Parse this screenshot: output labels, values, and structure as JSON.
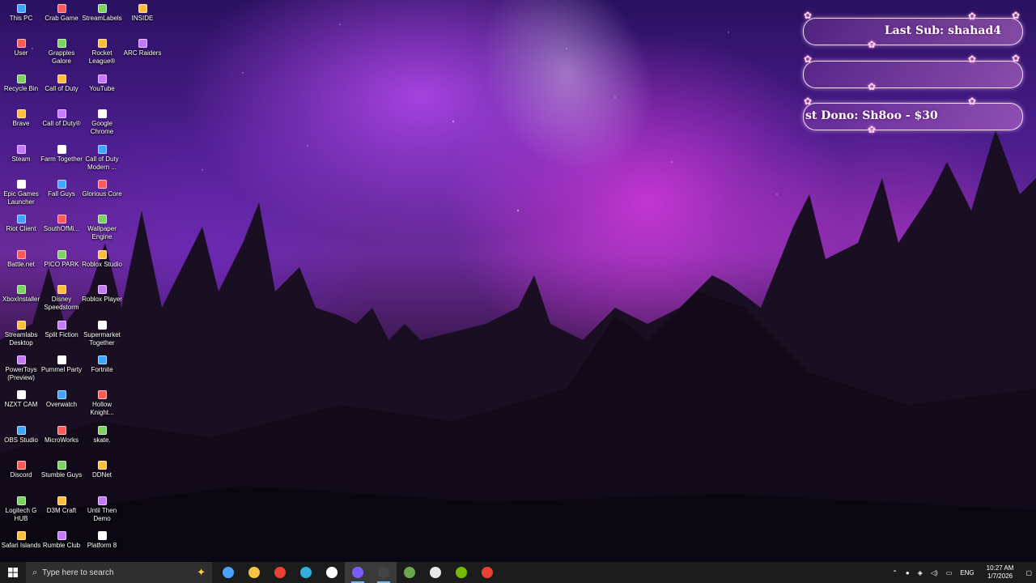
{
  "overlay": {
    "last_sub": "Last Sub: shahad4",
    "middle": "",
    "last_dono": "st Dono: Sh8oo - $30"
  },
  "desktop_icons": {
    "col1": [
      "This PC",
      "User",
      "Recycle Bin",
      "Brave",
      "Steam",
      "Epic Games Launcher",
      "Riot Client",
      "Battle.net",
      "XboxInstaller",
      "Streamlabs Desktop",
      "PowerToys (Preview)",
      "NZXT CAM",
      "OBS Studio",
      "Discord",
      "Logitech G HUB",
      "Safari Islands"
    ],
    "col2": [
      "Crab Game",
      "Grapples Galore",
      "Call of Duty",
      "Call of Duty®",
      "Farm Together",
      "Fall Guys",
      "SouthOfMi...",
      "PICO PARK",
      "Disney Speedstorm",
      "Split Fiction",
      "Pummel Party",
      "Overwatch",
      "MicroWorks",
      "Stumble Guys",
      "D3M Craft",
      "Rumble Club"
    ],
    "col3": [
      "StreamLabels",
      "Rocket League®",
      "YouTube",
      "Google Chrome",
      "Call of Duty Modern ...",
      "Glorious Core",
      "Wallpaper Engine",
      "Roblox Studio",
      "Roblox Player",
      "Supermarket Together",
      "Fortnite",
      "Hollow Knight...",
      "skate.",
      "DDNet",
      "Until Then Demo",
      "Platform 8"
    ],
    "col4": [
      "INSIDE",
      "ARC Raiders"
    ]
  },
  "taskbar": {
    "search_placeholder": "Type here to search",
    "apps": [
      "store-icon",
      "file-explorer-icon",
      "chrome-icon",
      "edge-icon",
      "steam-icon",
      "discord-icon",
      "obs-icon",
      "minecraft-icon",
      "box-icon",
      "nvidia-icon",
      "chrome-alt-icon"
    ],
    "language": "ENG",
    "time": "10:27 AM",
    "date": "1/7/2026"
  },
  "colors": {
    "accent": "#76b9ed",
    "taskbar_bg": "#1c1c1c",
    "overlay_glow": "#ff8ad8"
  }
}
